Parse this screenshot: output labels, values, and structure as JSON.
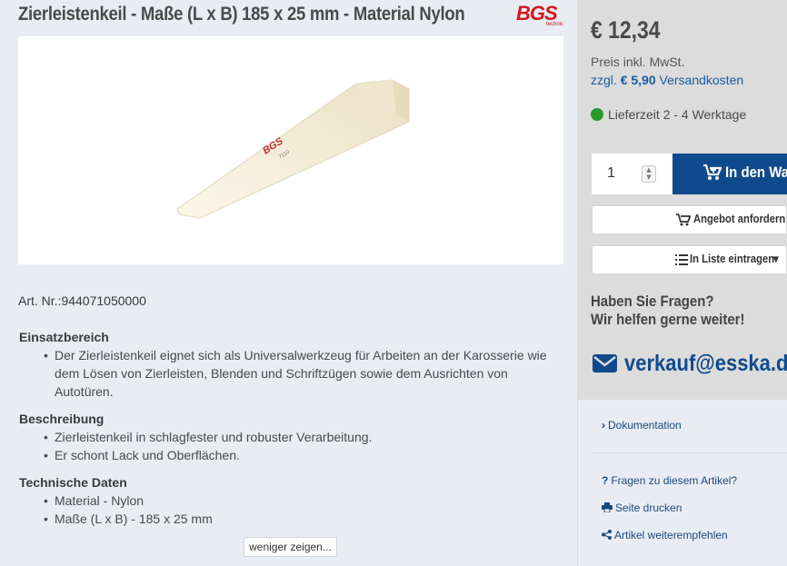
{
  "product": {
    "title": "Zierleistenkeil - Maße (L x B) 185 x 25 mm - Material Nylon",
    "brand_logo": "BGS",
    "brand_sub": "technic",
    "wedge_print": "BGS",
    "wedge_number": "7110",
    "article_number": "Art. Nr.:944071050000"
  },
  "sections": [
    {
      "heading": "Einsatzbereich",
      "bullets": [
        "Der Zierleistenkeil eignet sich als Universalwerkzeug für Arbeiten an der Karosserie wie dem Lösen von Zierleisten, Blenden und Schriftzügen sowie dem Ausrichten von Autotüren."
      ]
    },
    {
      "heading": "Beschreibung",
      "bullets": [
        "Zierleistenkeil in schlagfester und robuster Verarbeitung.",
        "Er schont Lack und Oberflächen."
      ]
    },
    {
      "heading": "Technische Daten",
      "bullets": [
        "Material - Nylon",
        "Maße (L x B) - 185 x 25 mm"
      ]
    }
  ],
  "show_less_label": "weniger zeigen...",
  "buybox": {
    "price": "€ 12,34",
    "vat_note": "Preis inkl. MwSt.",
    "shipping_prefix": "zzgl.",
    "shipping_amount": "€ 5,90",
    "shipping_link": "Versandkosten",
    "delivery": "Lieferzeit 2 - 4 Werktage",
    "delivery_color": "#2a9a2a",
    "quantity": "1",
    "cart_label": "In den Warenkorb",
    "quote_label": "Angebot anfordern",
    "list_label": "In Liste eintragen",
    "accent_color": "#114a8c"
  },
  "contact": {
    "question_line1": "Haben Sie Fragen?",
    "question_line2": "Wir helfen gerne weiter!",
    "email": "verkauf@esska.de"
  },
  "links": {
    "documentation": "Dokumentation",
    "question": "Fragen zu diesem Artikel?",
    "print": "Seite drucken",
    "recommend": "Artikel weiterempfehlen"
  }
}
